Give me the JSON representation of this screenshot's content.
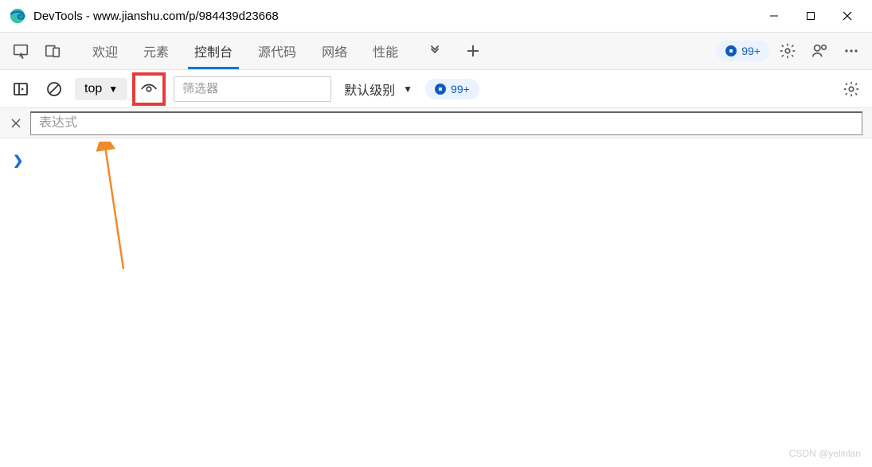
{
  "window": {
    "title": "DevTools - www.jianshu.com/p/984439d23668"
  },
  "tabs": {
    "welcome": "欢迎",
    "elements": "元素",
    "console": "控制台",
    "sources": "源代码",
    "network": "网络",
    "performance": "性能"
  },
  "tabbar": {
    "issues_badge": "99+"
  },
  "toolbar": {
    "context": "top",
    "filter_placeholder": "筛选器",
    "level": "默认级别",
    "issues_badge": "99+"
  },
  "expression": {
    "placeholder": "表达式"
  },
  "console": {
    "prompt": "❯"
  },
  "watermark": "CSDN @yelinlan"
}
